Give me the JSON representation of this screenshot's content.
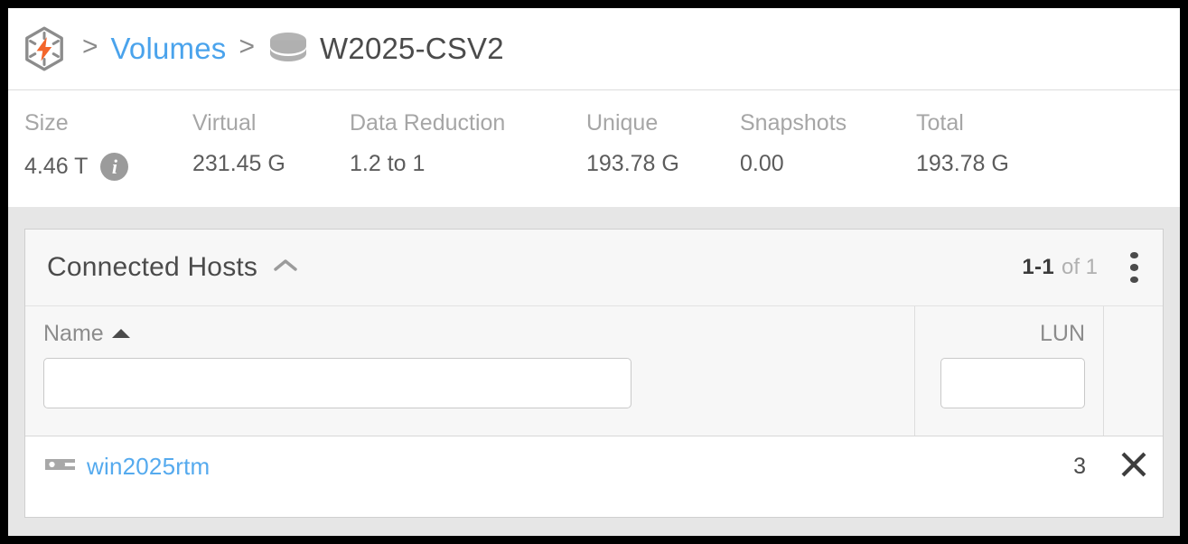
{
  "colors": {
    "brand_orange": "#f3652b",
    "link_blue": "#4aa3ec",
    "host_link_blue": "#55aaee",
    "icon_gray": "#9b9b9b",
    "text_dark": "#4b4b4b",
    "label_gray": "#a6a6a6",
    "page_bg": "#e6e6e6",
    "panel_bg": "#f7f7f7"
  },
  "breadcrumb": {
    "logo_icon": "pure-storage-hex-bolt-logo",
    "separator": ">",
    "root_label": "Volumes",
    "volume_icon": "volume-cylinder-icon",
    "current_label": "W2025-CSV2"
  },
  "stats": [
    {
      "label": "Size",
      "value": "4.46 T",
      "has_info": true,
      "info_icon": "info-icon"
    },
    {
      "label": "Virtual",
      "value": "231.45 G",
      "has_info": false
    },
    {
      "label": "Data Reduction",
      "value": "1.2 to 1",
      "has_info": false
    },
    {
      "label": "Unique",
      "value": "193.78 G",
      "has_info": false
    },
    {
      "label": "Snapshots",
      "value": "0.00",
      "has_info": false
    },
    {
      "label": "Total",
      "value": "193.78 G",
      "has_info": false
    }
  ],
  "panel": {
    "title": "Connected Hosts",
    "collapse_icon": "chevron-up-icon",
    "pager": {
      "range": "1-1",
      "of": "of 1"
    },
    "menu_icon": "kebab-menu-icon",
    "table": {
      "columns": [
        {
          "key": "name",
          "label": "Name",
          "sorted": true,
          "sort_icon": "sort-ascending-icon",
          "filter_value": "",
          "filter_placeholder": ""
        },
        {
          "key": "lun",
          "label": "LUN",
          "sorted": false,
          "filter_value": "",
          "filter_placeholder": ""
        }
      ],
      "rows": [
        {
          "icon": "host-icon",
          "name": "win2025rtm",
          "lun": "3",
          "action_icon": "disconnect-x-icon"
        }
      ]
    }
  }
}
